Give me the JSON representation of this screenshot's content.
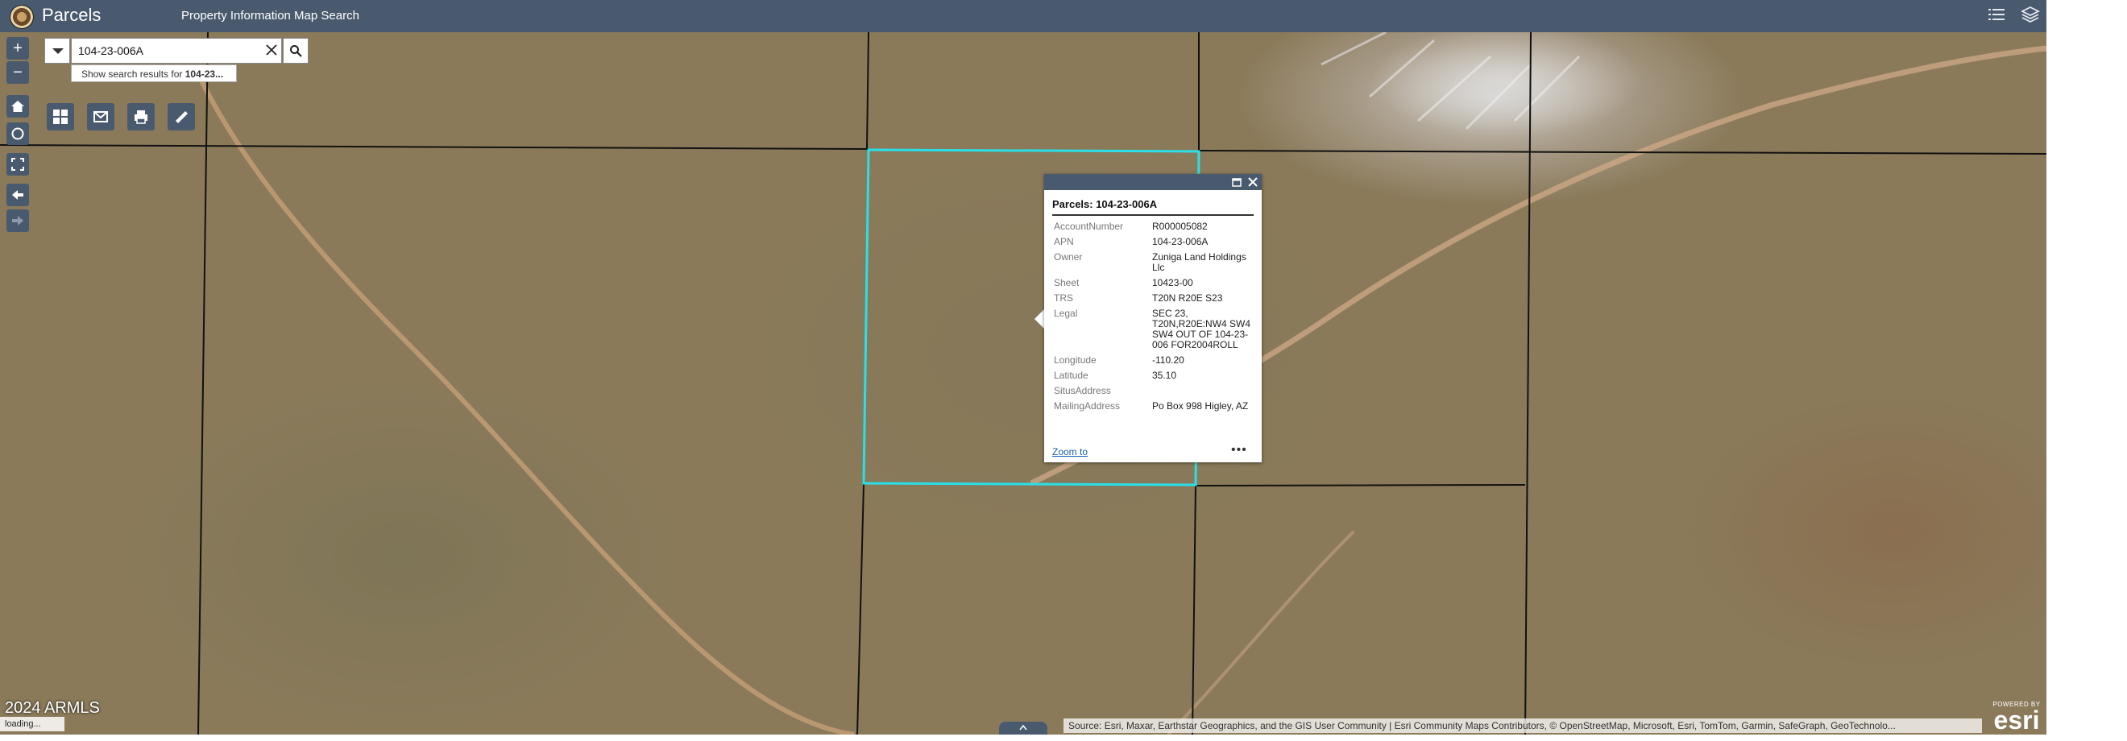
{
  "header": {
    "app_title": "Parcels",
    "subtitle": "Property Information Map Search",
    "icons": [
      "list-icon",
      "layers-icon"
    ]
  },
  "search": {
    "value": "104-23-006A",
    "suggestion_prefix": "Show search results for",
    "suggestion_value": "104-23..."
  },
  "toolbar": {
    "zoom_in": "+",
    "zoom_out": "−",
    "icons": [
      "home-icon",
      "locate-icon",
      "fullscreen-icon",
      "back-arrow-icon",
      "forward-arrow-icon",
      "basemap-gallery-icon",
      "share-icon",
      "print-icon",
      "measure-icon"
    ]
  },
  "popup": {
    "title": "Parcels: 104-23-006A",
    "fields": [
      {
        "key": "AccountNumber",
        "value": "R000005082"
      },
      {
        "key": "APN",
        "value": "104-23-006A"
      },
      {
        "key": "Owner",
        "value": "Zuniga Land Holdings Llc"
      },
      {
        "key": "Sheet",
        "value": "10423-00"
      },
      {
        "key": "TRS",
        "value": "T20N R20E S23"
      },
      {
        "key": "Legal",
        "value": "SEC 23, T20N,R20E:NW4 SW4 SW4 OUT OF 104-23-006 FOR2004ROLL"
      },
      {
        "key": "Longitude",
        "value": "-110.20"
      },
      {
        "key": "Latitude",
        "value": "35.10"
      },
      {
        "key": "SitusAddress",
        "value": ""
      },
      {
        "key": "MailingAddress",
        "value": "Po Box 998 Higley, AZ"
      }
    ],
    "zoom_link": "Zoom to",
    "more": "•••"
  },
  "footer": {
    "year_text": "2024 ARMLS",
    "loading": "loading...",
    "attribution": "Source: Esri, Maxar, Earthstar Geographics, and the GIS User Community | Esri Community Maps Contributors, © OpenStreetMap, Microsoft, Esri, TomTom, Garmin, SafeGraph, GeoTechnolo...",
    "powered_by": "POWERED BY",
    "esri_word": "esri"
  },
  "colors": {
    "header_bg": "#4a5a6e",
    "selected_parcel": "#29e0e8",
    "parcel_lines": "#111111"
  }
}
